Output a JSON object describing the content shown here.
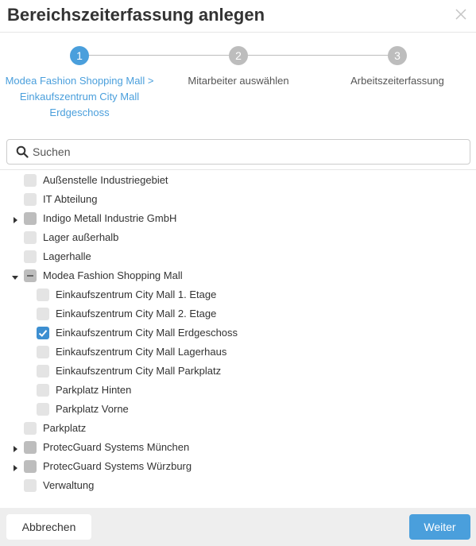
{
  "dialog": {
    "title": "Bereichszeiterfassung anlegen"
  },
  "stepper": {
    "steps": [
      {
        "number": "1",
        "label_lines": [
          "Modea Fashion Shopping Mall >",
          "Einkaufszentrum City Mall",
          "Erdgeschoss"
        ],
        "state": "active"
      },
      {
        "number": "2",
        "label_lines": [
          "Mitarbeiter auswählen"
        ],
        "state": "inactive"
      },
      {
        "number": "3",
        "label_lines": [
          "Arbeitszeiterfassung"
        ],
        "state": "inactive"
      }
    ]
  },
  "search": {
    "placeholder": "Suchen",
    "value": ""
  },
  "tree": {
    "items": [
      {
        "label": "Außenstelle Industriegebiet",
        "level": 0,
        "expander": "none",
        "check": "unchecked"
      },
      {
        "label": "IT Abteilung",
        "level": 0,
        "expander": "none",
        "check": "unchecked"
      },
      {
        "label": "Indigo Metall Industrie GmbH",
        "level": 0,
        "expander": "collapsed",
        "check": "unchecked-parent"
      },
      {
        "label": "Lager außerhalb",
        "level": 0,
        "expander": "none",
        "check": "unchecked"
      },
      {
        "label": "Lagerhalle",
        "level": 0,
        "expander": "none",
        "check": "unchecked"
      },
      {
        "label": "Modea Fashion Shopping Mall",
        "level": 0,
        "expander": "expanded",
        "check": "indeterminate"
      },
      {
        "label": "Einkaufszentrum City Mall 1. Etage",
        "level": 1,
        "expander": "none",
        "check": "unchecked"
      },
      {
        "label": "Einkaufszentrum City Mall 2. Etage",
        "level": 1,
        "expander": "none",
        "check": "unchecked"
      },
      {
        "label": "Einkaufszentrum City Mall Erdgeschoss",
        "level": 1,
        "expander": "none",
        "check": "checked"
      },
      {
        "label": "Einkaufszentrum City Mall Lagerhaus",
        "level": 1,
        "expander": "none",
        "check": "unchecked"
      },
      {
        "label": "Einkaufszentrum City Mall Parkplatz",
        "level": 1,
        "expander": "none",
        "check": "unchecked"
      },
      {
        "label": "Parkplatz Hinten",
        "level": 1,
        "expander": "none",
        "check": "unchecked"
      },
      {
        "label": "Parkplatz Vorne",
        "level": 1,
        "expander": "none",
        "check": "unchecked"
      },
      {
        "label": "Parkplatz",
        "level": 0,
        "expander": "none",
        "check": "unchecked"
      },
      {
        "label": "ProtecGuard Systems München",
        "level": 0,
        "expander": "collapsed",
        "check": "unchecked-parent"
      },
      {
        "label": "ProtecGuard Systems Würzburg",
        "level": 0,
        "expander": "collapsed",
        "check": "unchecked-parent"
      },
      {
        "label": "Verwaltung",
        "level": 0,
        "expander": "none",
        "check": "unchecked"
      }
    ]
  },
  "footer": {
    "cancel_label": "Abbrechen",
    "next_label": "Weiter"
  },
  "colors": {
    "accent": "#4a9fdc",
    "checked": "#3d8fd1",
    "inactive_step": "#bdbdbd",
    "footer_bg": "#eeeeee"
  }
}
